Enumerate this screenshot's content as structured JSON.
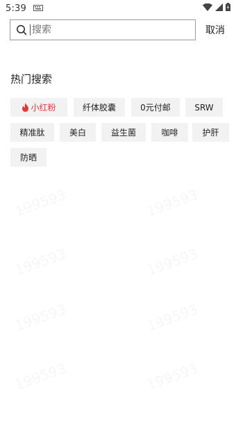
{
  "status": {
    "time": "5:39"
  },
  "search": {
    "placeholder": "搜索",
    "cancel_label": "取消"
  },
  "hot": {
    "title": "热门搜索",
    "tags": [
      "小红粉",
      "纤体胶囊",
      "0元付邮",
      "SRW",
      "精准肽",
      "美白",
      "益生菌",
      "咖啡",
      "护肝",
      "防晒"
    ]
  },
  "colors": {
    "hot_tag": "#e4393c",
    "tag_bg": "#f2f2f2"
  },
  "watermark": "199593"
}
